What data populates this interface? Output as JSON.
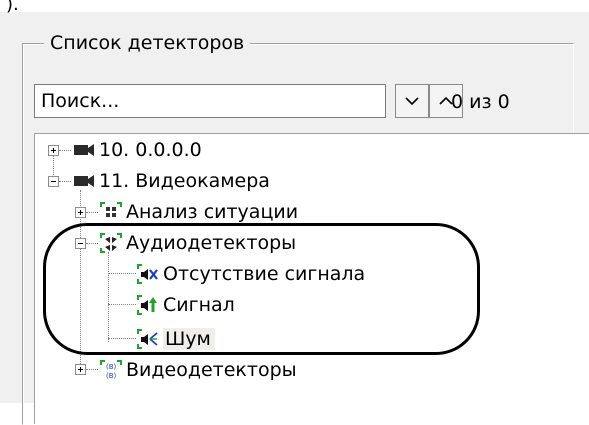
{
  "header_fragment": ").",
  "group": {
    "title": "Список детекторов"
  },
  "search": {
    "value": "Поиск...",
    "counter": "0 из 0"
  },
  "icons": {
    "prev": "chevron-down-icon",
    "next": "chevron-up-icon"
  },
  "tree": {
    "items": [
      {
        "label": "10. 0.0.0.0",
        "icon": "camera-icon",
        "expand": "plus"
      },
      {
        "label": "11. Видеокамера",
        "icon": "camera-icon",
        "expand": "minus"
      },
      {
        "label": "Анализ ситуации",
        "icon": "situation-analysis-icon",
        "expand": "plus"
      },
      {
        "label": "Аудиодетекторы",
        "icon": "audio-detectors-icon",
        "expand": "minus"
      },
      {
        "label": "Отсутствие сигнала",
        "icon": "speaker-no-signal-icon"
      },
      {
        "label": "Сигнал",
        "icon": "speaker-signal-icon"
      },
      {
        "label": "Шум",
        "icon": "speaker-noise-icon",
        "selected": true
      },
      {
        "label": "Видеодетекторы",
        "icon": "video-detectors-icon",
        "expand": "plus"
      }
    ]
  }
}
